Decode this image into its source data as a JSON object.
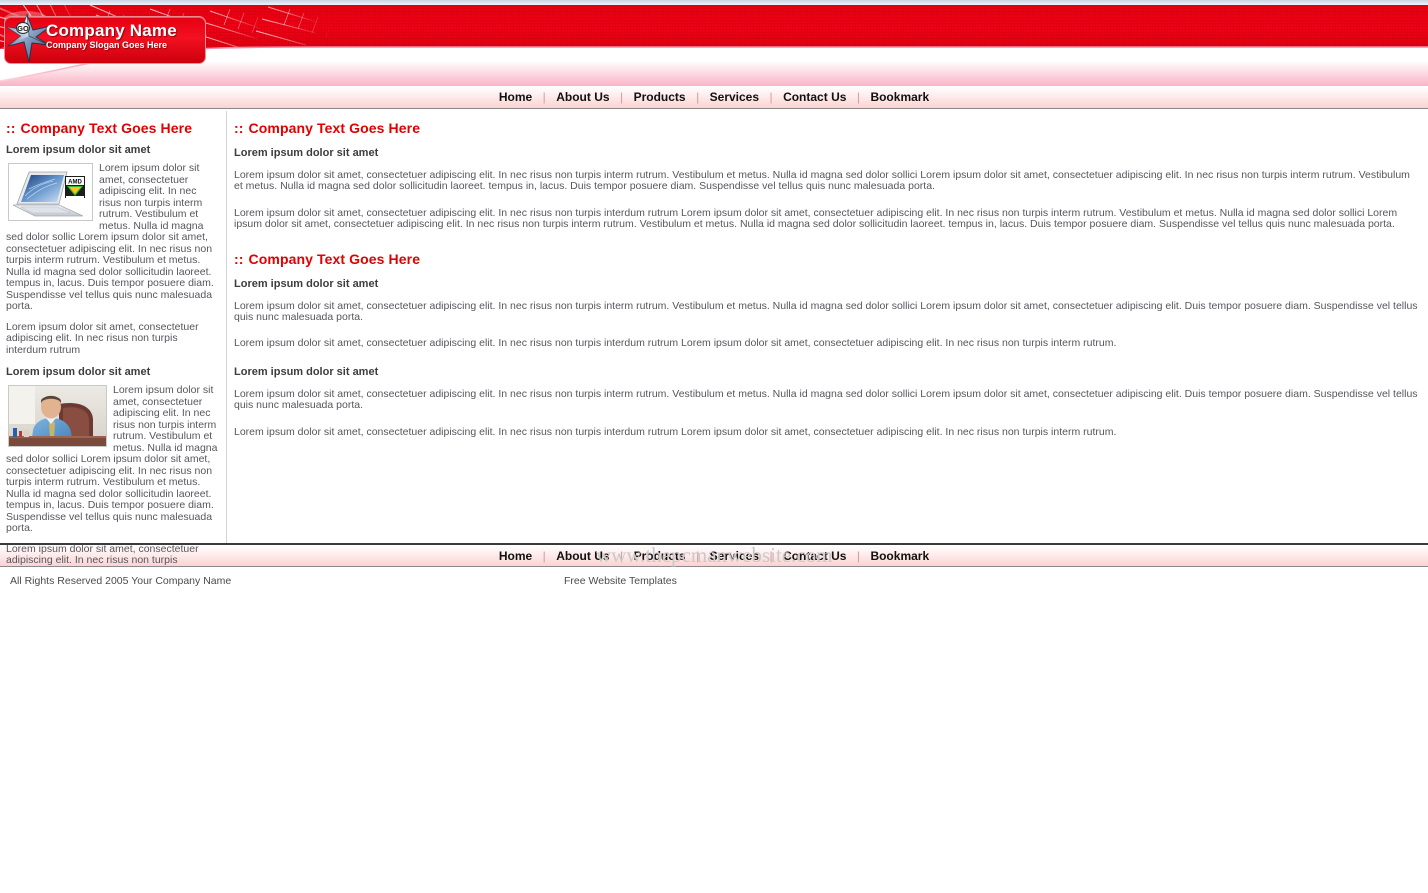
{
  "header": {
    "logo_icon": "star-compass-logo",
    "logo_badge_text": "GO",
    "company_name": "Company Name",
    "company_slogan": "Company Slogan Goes Here"
  },
  "nav": {
    "items": [
      {
        "label": "Home"
      },
      {
        "label": "About Us"
      },
      {
        "label": "Products"
      },
      {
        "label": "Services"
      },
      {
        "label": "Contact Us"
      },
      {
        "label": "Bookmark"
      }
    ],
    "separator": "|"
  },
  "sidebar": {
    "section_title": "Company Text Goes Here",
    "colons": "::",
    "blocks": [
      {
        "heading": "Lorem ipsum dolor sit amet",
        "image": "laptop-amd-thumbnail",
        "wrapped_text": "Lorem ipsum dolor sit amet, consectetuer adipiscing elit. In nec risus non turpis interm rutrum. Vestibulum et metus. Nulla id magna sed dolor sollic Lorem ipsum dolor sit amet, consectetuer adipiscing elit. In nec risus non turpis interm rutrum. Vestibulum et metus. Nulla id magna sed dolor sollicitudin laoreet. tempus in, lacus. Duis tempor posuere diam. Suspendisse vel tellus quis nunc malesuada porta.",
        "after_text": "Lorem ipsum dolor sit amet, consectetuer adipiscing elit. In nec risus non turpis interdum rutrum"
      },
      {
        "heading": "Lorem ipsum dolor sit amet",
        "image": "businessman-desk-thumbnail",
        "wrapped_text": "Lorem ipsum dolor sit amet, consectetuer adipiscing elit. In nec risus non turpis interm rutrum. Vestibulum et metus. Nulla id magna sed dolor sollici Lorem ipsum dolor sit amet, consectetuer adipiscing elit. In nec risus non turpis interm rutrum. Vestibulum et metus. Nulla id magna sed dolor sollicitudin laoreet. tempus in, lacus. Duis tempor posuere diam. Suspendisse vel tellus quis nunc malesuada porta.",
        "after_text": "Lorem ipsum dolor sit amet, consectetuer adipiscing elit. In nec risus non turpis interdum rutrum"
      }
    ]
  },
  "main": {
    "colons": "::",
    "sections": [
      {
        "title": "Company Text Goes Here",
        "heading": "Lorem ipsum dolor sit amet",
        "paragraphs": [
          "Lorem ipsum dolor sit amet, consectetuer adipiscing elit. In nec risus non turpis interm rutrum. Vestibulum et metus. Nulla id magna sed dolor sollici Lorem ipsum dolor sit amet, consectetuer adipiscing elit. In nec risus non turpis interm rutrum. Vestibulum et metus. Nulla id magna sed dolor sollicitudin laoreet. tempus in, lacus. Duis tempor posuere diam. Suspendisse vel tellus quis nunc malesuada porta.",
          "Lorem ipsum dolor sit amet, consectetuer adipiscing elit. In nec risus non turpis interdum rutrum Lorem ipsum dolor sit amet, consectetuer adipiscing elit. In nec risus non turpis interm rutrum. Vestibulum et metus. Nulla id magna sed dolor sollici Lorem ipsum dolor sit amet, consectetuer adipiscing elit. In nec risus non turpis interm rutrum. Vestibulum et metus. Nulla id magna sed dolor sollicitudin laoreet. tempus in, lacus. Duis tempor posuere diam. Suspendisse vel tellus quis nunc malesuada porta."
        ]
      },
      {
        "title": "Company Text Goes Here",
        "heading": "Lorem ipsum dolor sit amet",
        "paragraphs": [
          "Lorem ipsum dolor sit amet, consectetuer adipiscing elit. In nec risus non turpis interm rutrum. Vestibulum et metus. Nulla id magna sed dolor sollici Lorem ipsum dolor sit amet, consectetuer adipiscing elit. Duis tempor posuere diam. Suspendisse vel tellus quis nunc malesuada porta.",
          "Lorem ipsum dolor sit amet, consectetuer adipiscing elit. In nec risus non turpis interdum rutrum Lorem ipsum dolor sit amet, consectetuer adipiscing elit. In nec risus non turpis interm rutrum."
        ]
      }
    ],
    "subsection": {
      "heading": "Lorem ipsum dolor sit amet",
      "paragraphs": [
        "Lorem ipsum dolor sit amet, consectetuer adipiscing elit. In nec risus non turpis interm rutrum. Vestibulum et metus. Nulla id magna sed dolor sollici Lorem ipsum dolor sit amet, consectetuer adipiscing elit. Duis tempor posuere diam. Suspendisse vel tellus quis nunc malesuada porta.",
        "Lorem ipsum dolor sit amet, consectetuer adipiscing elit. In nec risus non turpis interdum rutrum Lorem ipsum dolor sit amet, consectetuer adipiscing elit. In nec risus non turpis interm rutrum."
      ]
    },
    "watermark": "www.thepcmanwebsite.com"
  },
  "footer": {
    "copyright": "All Rights Reserved 2005 Your Company Name",
    "credit": "Free Website Templates"
  },
  "colors": {
    "brand_red": "#e10000",
    "banner_red": "#f00014",
    "nav_pink": "#fbd2d2",
    "body_text": "#56565e",
    "watermark_gray": "#c9c9c9"
  }
}
